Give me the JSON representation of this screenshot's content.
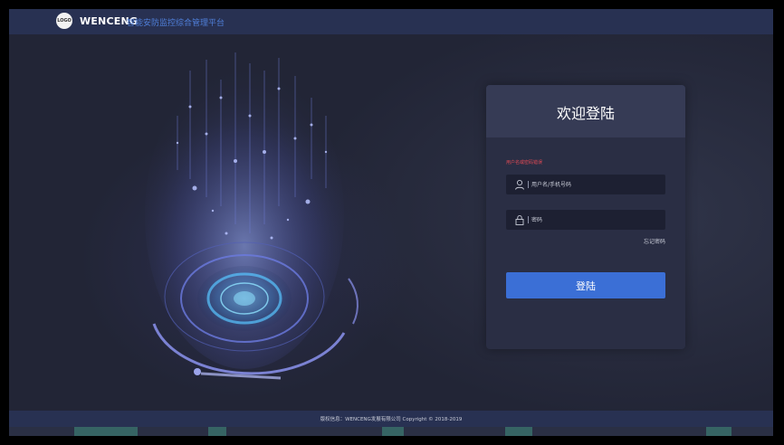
{
  "header": {
    "logo_text": "LOGO",
    "brand": "WENCENG",
    "platform_name": "智能安防监控综合管理平台"
  },
  "login": {
    "title": "欢迎登陆",
    "error_message": "用户名或密码错误",
    "username_placeholder": "用户名/手机号码",
    "password_placeholder": "密码",
    "forgot_password": "忘记密码",
    "submit_label": "登陆"
  },
  "footer": {
    "copyright": "版权信息：WENCENG发展有限公司 Copyright © 2018-2019"
  },
  "colors": {
    "page_bg": "#222536",
    "header_bg": "#283152",
    "accent": "#3b6fd6",
    "error": "#e04a55",
    "card_bg": "#2a2e44"
  }
}
